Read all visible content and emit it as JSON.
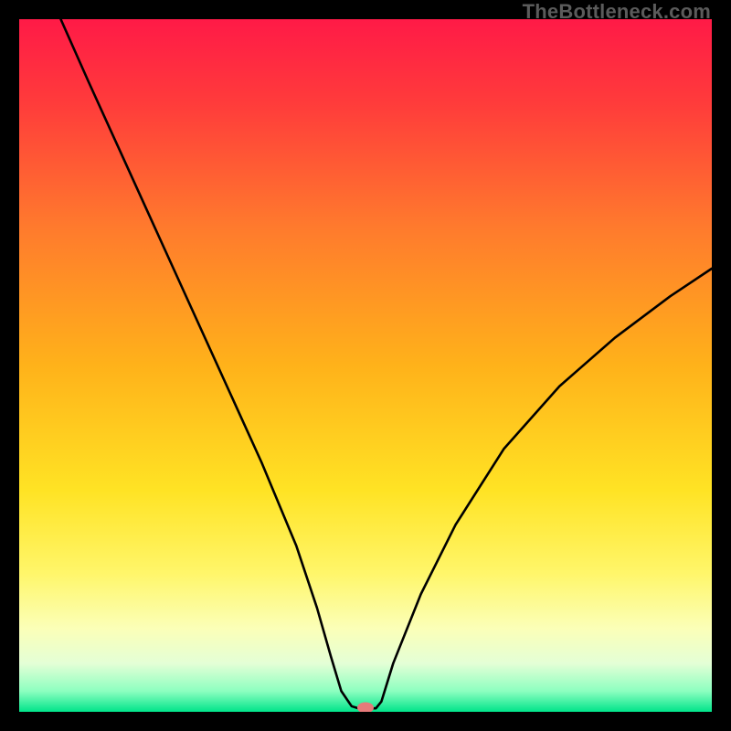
{
  "watermark": "TheBottleneck.com",
  "chart_data": {
    "type": "line",
    "title": "",
    "xlabel": "",
    "ylabel": "",
    "xlim": [
      0,
      100
    ],
    "ylim": [
      0,
      100
    ],
    "grid": false,
    "legend": false,
    "gradient_stops": [
      {
        "offset": 0.0,
        "color": "#ff1a47"
      },
      {
        "offset": 0.12,
        "color": "#ff3b3b"
      },
      {
        "offset": 0.3,
        "color": "#ff7a2d"
      },
      {
        "offset": 0.5,
        "color": "#ffb21a"
      },
      {
        "offset": 0.68,
        "color": "#ffe324"
      },
      {
        "offset": 0.8,
        "color": "#fff66a"
      },
      {
        "offset": 0.88,
        "color": "#fbffb8"
      },
      {
        "offset": 0.93,
        "color": "#e4ffd6"
      },
      {
        "offset": 0.97,
        "color": "#8dffc0"
      },
      {
        "offset": 1.0,
        "color": "#00e48a"
      }
    ],
    "curve": {
      "x": [
        6,
        10,
        15,
        20,
        25,
        30,
        35,
        40,
        43,
        45,
        46.5,
        48,
        49,
        49.6,
        51.5,
        52.3,
        54,
        58,
        63,
        70,
        78,
        86,
        94,
        100
      ],
      "y": [
        100,
        91,
        80,
        69,
        58,
        47,
        36,
        24,
        15,
        8,
        3,
        0.8,
        0.5,
        0.5,
        0.5,
        1.5,
        7,
        17,
        27,
        38,
        47,
        54,
        60,
        64
      ]
    },
    "marker": {
      "x": 50.0,
      "y": 0.6,
      "color": "#e77a7a",
      "rx": 9,
      "ry": 6
    },
    "flat_segment": {
      "x0": 46.5,
      "x1": 51.5,
      "y": 0.55
    }
  }
}
